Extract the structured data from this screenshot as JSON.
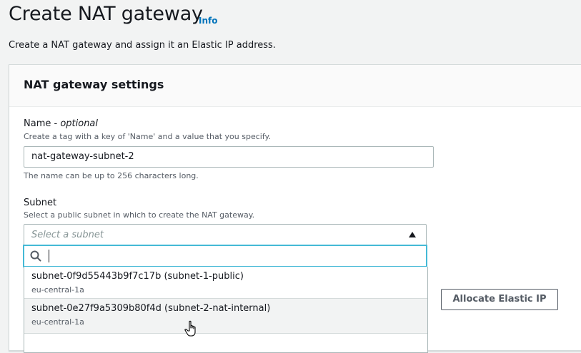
{
  "page": {
    "title": "Create NAT gateway",
    "info_link": "Info",
    "description": "Create a NAT gateway and assign it an Elastic IP address."
  },
  "panel": {
    "title": "NAT gateway settings",
    "name_field": {
      "label": "Name",
      "label_optional": "optional",
      "hint": "Create a tag with a key of 'Name' and a value that you specify.",
      "value": "nat-gateway-subnet-2",
      "constraint": "The name can be up to 256 characters long."
    },
    "subnet_field": {
      "label": "Subnet",
      "hint": "Select a public subnet in which to create the NAT gateway.",
      "placeholder": "Select a subnet",
      "search_value": "",
      "options": [
        {
          "title": "subnet-0f9d55443b9f7c17b (subnet-1-public)",
          "zone": "eu-central-1a"
        },
        {
          "title": "subnet-0e27f9a5309b80f4d (subnet-2-nat-internal)",
          "zone": "eu-central-1a"
        }
      ]
    },
    "allocate_button": "Allocate Elastic IP"
  },
  "icons": {
    "search": "search-icon",
    "caret": "caret-up-icon",
    "pointer": "hand-pointer-icon"
  },
  "colors": {
    "link": "#0073bb",
    "focus": "#44b9d6",
    "background": "#f2f3f3"
  }
}
